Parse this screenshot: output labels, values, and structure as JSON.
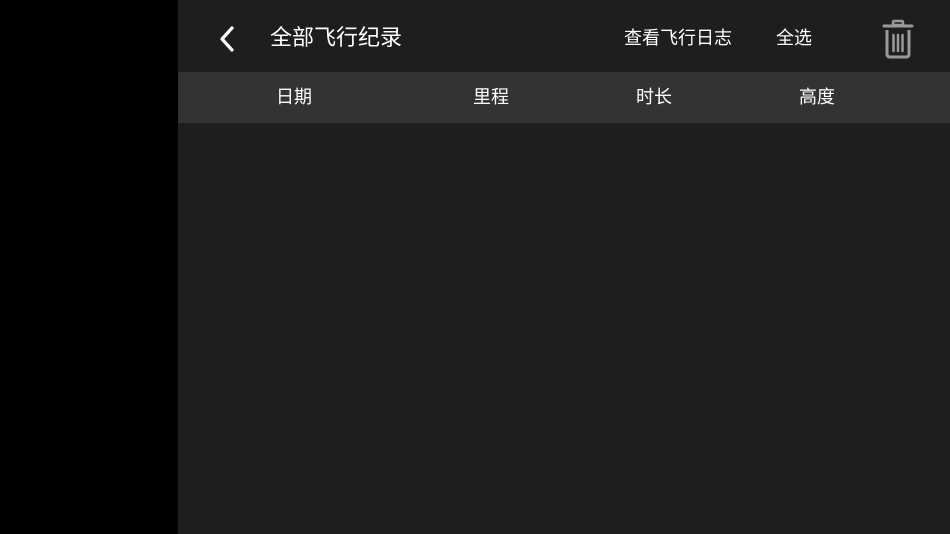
{
  "header": {
    "title": "全部飞行纪录",
    "view_log_label": "查看飞行日志",
    "select_all_label": "全选",
    "back_icon": "chevron-left-icon",
    "delete_icon": "trash-icon"
  },
  "table": {
    "columns": [
      "日期",
      "里程",
      "时长",
      "高度"
    ],
    "rows": []
  },
  "colors": {
    "background": "#1e1e1e",
    "header_row": "#333333",
    "side_area": "#000000",
    "text": "#ffffff",
    "icon_gray": "#9a9a9a"
  }
}
